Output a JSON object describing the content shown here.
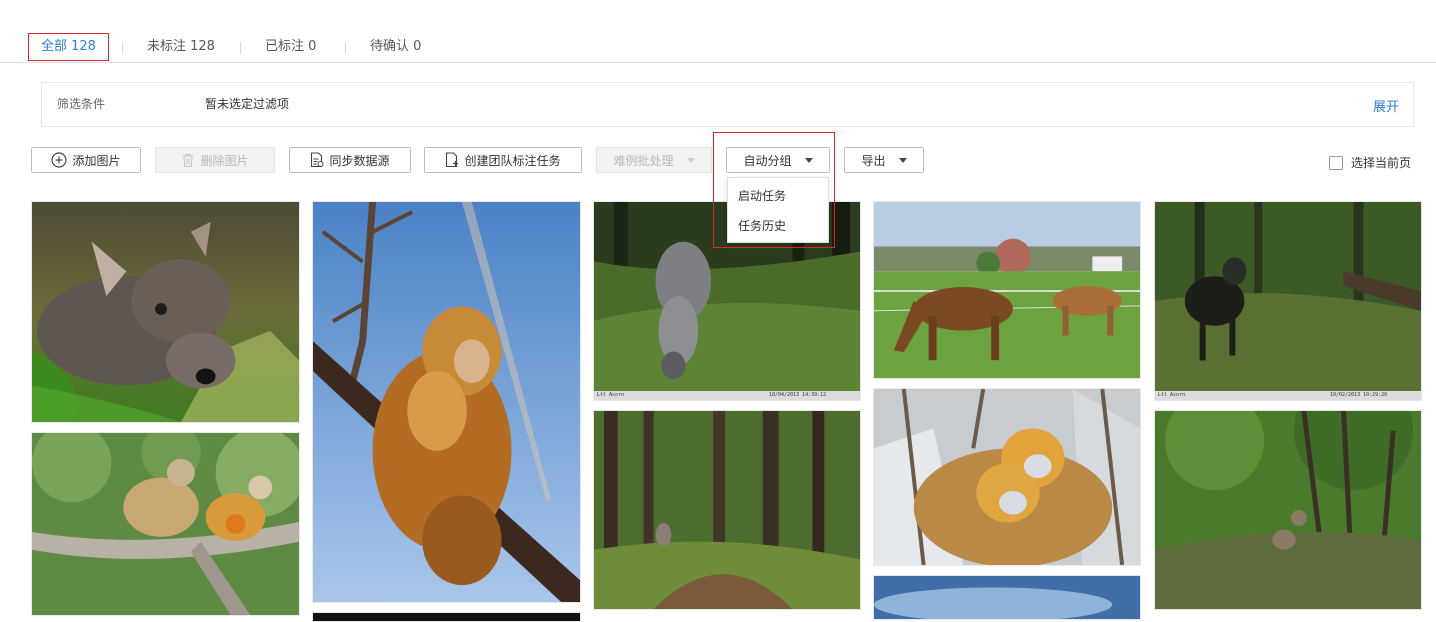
{
  "tabs": [
    {
      "label": "全部 128"
    },
    {
      "label": "未标注 128"
    },
    {
      "label": "已标注 0"
    },
    {
      "label": "待确认 0"
    }
  ],
  "filter": {
    "label": "筛选条件",
    "value": "暂未选定过滤项",
    "expand": "展开"
  },
  "toolbar": {
    "add": "添加图片",
    "delete": "删除图片",
    "sync": "同步数据源",
    "team": "创建团队标注任务",
    "hard": "难例批处理",
    "autogroup": "自动分组",
    "export": "导出",
    "select_page": "选择当前页"
  },
  "autogroup_menu": [
    "启动任务",
    "任务历史"
  ],
  "camera": {
    "brand": "Ltl Acorn",
    "tile3": "10/04/2013  14:39:12",
    "tile5": "10/02/2013  10:29:20"
  },
  "colors": {
    "accent": "#2f7cd3",
    "highlight": "#d8262c"
  }
}
